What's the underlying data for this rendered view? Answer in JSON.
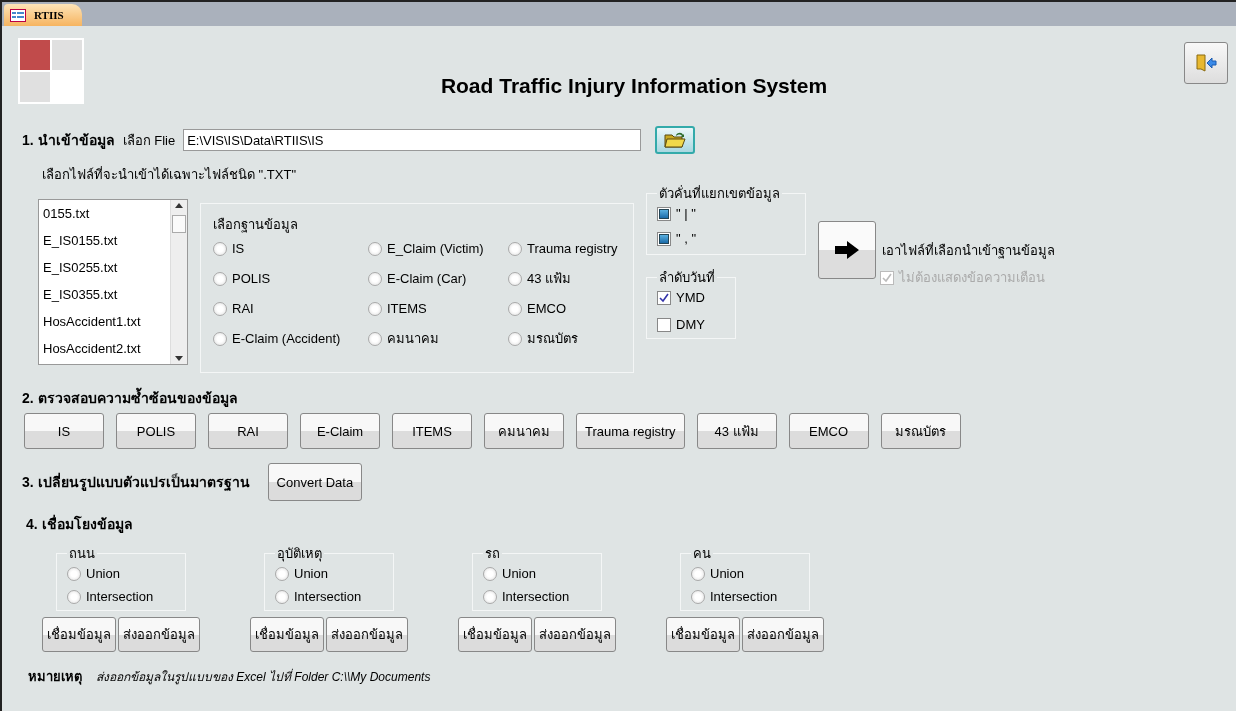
{
  "tabs": [
    {
      "label": "RTIIS",
      "selected": true
    }
  ],
  "title": "Road Traffic Injury Information System",
  "import": {
    "heading": "1. นำเข้าข้อมูล",
    "file_label": "เลือก Flie",
    "file_path": "E:\\VIS\\IS\\Data\\RTIIS\\IS",
    "hint": "เลือกไฟล์ที่จะนำเข้าได้เฉพาะไฟล์ชนิด \".TXT\"",
    "files": [
      {
        "name": "0155.txt",
        "selected": false
      },
      {
        "name": "E_IS0155.txt",
        "selected": false
      },
      {
        "name": "E_IS0255.txt",
        "selected": false
      },
      {
        "name": "E_IS0355.txt",
        "selected": false
      },
      {
        "name": "HosAccident1.txt",
        "selected": false
      },
      {
        "name": "HosAccident2.txt",
        "selected": false
      }
    ],
    "database_group": {
      "title": "เลือกฐานข้อมูล",
      "options": [
        {
          "label": "IS",
          "selected": false
        },
        {
          "label": "E_Claim (Victim)",
          "selected": false
        },
        {
          "label": "Trauma registry",
          "selected": false
        },
        {
          "label": "POLIS",
          "selected": false
        },
        {
          "label": "E-Claim (Car)",
          "selected": false
        },
        {
          "label": "43 แฟ้ม",
          "selected": false
        },
        {
          "label": "RAI",
          "selected": false
        },
        {
          "label": "ITEMS",
          "selected": false
        },
        {
          "label": "EMCO",
          "selected": false
        },
        {
          "label": "E-Claim (Accident)",
          "selected": false
        },
        {
          "label": "คมนาคม",
          "selected": false
        },
        {
          "label": "มรณบัตร",
          "selected": false
        }
      ]
    },
    "separator_group": {
      "title": "ตัวคั่นที่แยกเขตข้อมูล",
      "options": [
        {
          "label": "\" | \"",
          "checked": true
        },
        {
          "label": "\" , \"",
          "checked": true
        }
      ]
    },
    "date_group": {
      "title": "ลำดับวันที่",
      "options": [
        {
          "label": "YMD",
          "checked": true
        },
        {
          "label": "DMY",
          "checked": false
        }
      ]
    },
    "import_label": "เอาไฟล์ที่เลือกนำเข้าฐานข้อมูล",
    "no_warning": {
      "label": "ไม่ต้องแสดงข้อความเตือน",
      "checked": true,
      "disabled": true
    }
  },
  "dedupe": {
    "heading": "2. ตรวจสอบความซ้ำซ้อนของข้อมูล",
    "buttons": [
      "IS",
      "POLIS",
      "RAI",
      "E-Claim",
      "ITEMS",
      "คมนาคม",
      "Trauma registry",
      "43 แฟ้ม",
      "EMCO",
      "มรณบัตร"
    ]
  },
  "convert": {
    "heading": "3. เปลี่ยนรูปแบบตัวแปรเป็นมาตรฐาน",
    "button": "Convert Data"
  },
  "link": {
    "heading": "4. เชื่อมโยงข้อมูล",
    "groups": [
      {
        "title": "ถนน",
        "options": [
          {
            "label": "Union",
            "selected": false
          },
          {
            "label": "Intersection",
            "selected": false
          }
        ],
        "buttons": [
          "เชื่อมข้อมูล",
          "ส่งออกข้อมูล"
        ]
      },
      {
        "title": "อุบัติเหตุ",
        "options": [
          {
            "label": "Union",
            "selected": false
          },
          {
            "label": "Intersection",
            "selected": false
          }
        ],
        "buttons": [
          "เชื่อมข้อมูล",
          "ส่งออกข้อมูล"
        ]
      },
      {
        "title": "รถ",
        "options": [
          {
            "label": "Union",
            "selected": false
          },
          {
            "label": "Intersection",
            "selected": false
          }
        ],
        "buttons": [
          "เชื่อมข้อมูล",
          "ส่งออกข้อมูล"
        ]
      },
      {
        "title": "คน",
        "options": [
          {
            "label": "Union",
            "selected": false
          },
          {
            "label": "Intersection",
            "selected": false
          }
        ],
        "buttons": [
          "เชื่อมข้อมูล",
          "ส่งออกข้อมูล"
        ]
      }
    ]
  },
  "note": {
    "label": "หมายเหตุ",
    "text": "ส่งออกข้อมูลในรูปแบบของ Excel ไปที่ Folder C:\\\\My Documents"
  }
}
